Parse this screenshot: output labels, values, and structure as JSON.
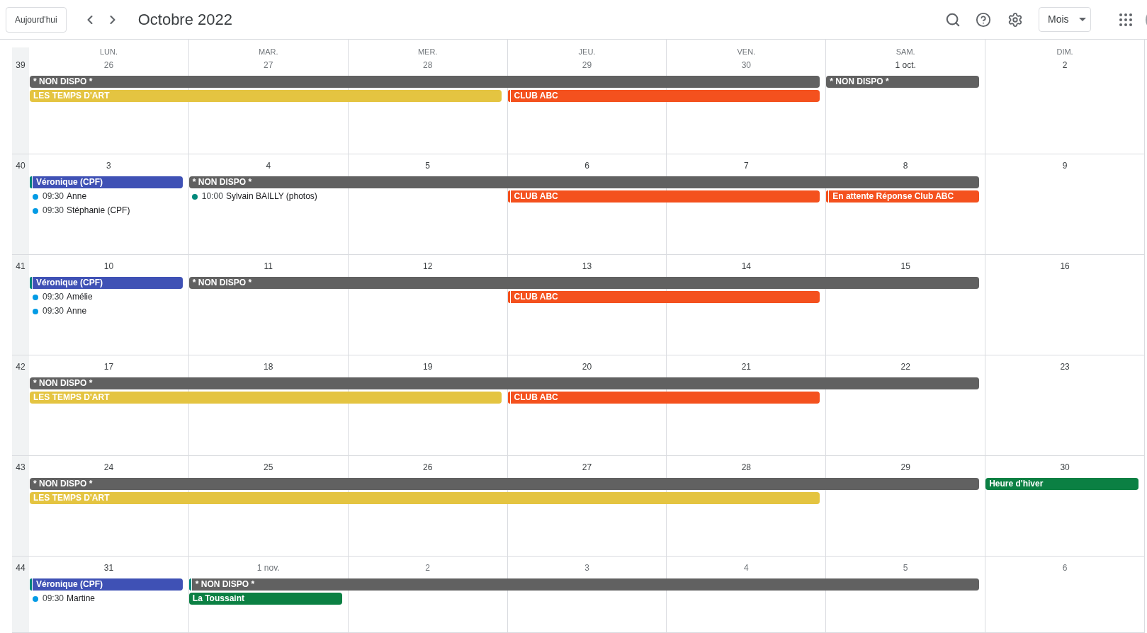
{
  "toolbar": {
    "today_button": "Aujourd'hui",
    "title": "Octobre 2022",
    "view_button": "Mois"
  },
  "day_names": [
    "LUN.",
    "MAR.",
    "MER.",
    "JEU.",
    "VEN.",
    "SAM.",
    "DIM."
  ],
  "weeks": [
    {
      "number": "39",
      "days": [
        {
          "label": "26",
          "in_month": false
        },
        {
          "label": "27",
          "in_month": false
        },
        {
          "label": "28",
          "in_month": false
        },
        {
          "label": "29",
          "in_month": false
        },
        {
          "label": "30",
          "in_month": false
        },
        {
          "label": "1 oct.",
          "in_month": true
        },
        {
          "label": "2",
          "in_month": true
        }
      ],
      "lanes": [
        [
          {
            "kind": "bar",
            "title": "* NON DISPO *",
            "color": "#616161"
          },
          {
            "kind": "continued"
          },
          {
            "kind": "continued"
          },
          {
            "kind": "continued"
          },
          {
            "kind": "continued"
          },
          {
            "kind": "bar",
            "title": "* NON DISPO *",
            "color": "#616161"
          }
        ],
        [
          {
            "kind": "bar",
            "title": "LES TEMPS D'ART",
            "color": "#e4c441"
          },
          {
            "kind": "continued"
          },
          {
            "kind": "continued"
          },
          {
            "kind": "bar",
            "title": "CLUB ABC",
            "color": "#f4511e",
            "stripe": {
              "color": "#f4511e"
            }
          },
          {
            "kind": "continued"
          }
        ]
      ]
    },
    {
      "number": "40",
      "days": [
        {
          "label": "3",
          "in_month": true
        },
        {
          "label": "4",
          "in_month": true
        },
        {
          "label": "5",
          "in_month": true
        },
        {
          "label": "6",
          "in_month": true
        },
        {
          "label": "7",
          "in_month": true
        },
        {
          "label": "8",
          "in_month": true
        },
        {
          "label": "9",
          "in_month": true
        }
      ],
      "lanes": [
        [
          {
            "kind": "bar",
            "title": "Véronique (CPF)",
            "color": "#3f51b5",
            "stripe": {
              "color": "#00897b"
            }
          },
          {
            "kind": "bar",
            "title": "* NON DISPO *",
            "color": "#616161"
          },
          {
            "kind": "continued"
          },
          {
            "kind": "continued"
          },
          {
            "kind": "continued"
          },
          {
            "kind": "continued"
          }
        ],
        [
          {
            "kind": "timed",
            "time": "09:30",
            "title": "Anne",
            "color": "#039be5"
          },
          {
            "kind": "timed",
            "time": "10:00",
            "title": "Sylvain BAILLY (photos)",
            "color": "#00897b"
          },
          {
            "kind": "free"
          },
          {
            "kind": "bar",
            "title": "CLUB ABC",
            "color": "#f4511e",
            "stripe": {
              "color": "#f4511e"
            }
          },
          {
            "kind": "continued"
          },
          {
            "kind": "bar",
            "title": "En attente Réponse Club ABC",
            "color": "#f4511e",
            "stripe": {
              "color": "#f4511e"
            }
          }
        ],
        [
          {
            "kind": "timed",
            "time": "09:30",
            "title": "Stéphanie (CPF)",
            "color": "#039be5"
          }
        ]
      ]
    },
    {
      "number": "41",
      "days": [
        {
          "label": "10",
          "in_month": true
        },
        {
          "label": "11",
          "in_month": true
        },
        {
          "label": "12",
          "in_month": true
        },
        {
          "label": "13",
          "in_month": true
        },
        {
          "label": "14",
          "in_month": true
        },
        {
          "label": "15",
          "in_month": true
        },
        {
          "label": "16",
          "in_month": true
        }
      ],
      "lanes": [
        [
          {
            "kind": "bar",
            "title": "Véronique (CPF)",
            "color": "#3f51b5",
            "stripe": {
              "color": "#00897b"
            }
          },
          {
            "kind": "bar",
            "title": "* NON DISPO *",
            "color": "#616161"
          },
          {
            "kind": "continued"
          },
          {
            "kind": "continued"
          },
          {
            "kind": "continued"
          },
          {
            "kind": "continued"
          }
        ],
        [
          {
            "kind": "timed",
            "time": "09:30",
            "title": "Amélie",
            "color": "#039be5"
          },
          {
            "kind": "free"
          },
          {
            "kind": "free"
          },
          {
            "kind": "bar",
            "title": "CLUB ABC",
            "color": "#f4511e",
            "stripe": {
              "color": "#f4511e"
            }
          },
          {
            "kind": "continued"
          }
        ],
        [
          {
            "kind": "timed",
            "time": "09:30",
            "title": "Anne",
            "color": "#039be5"
          }
        ]
      ]
    },
    {
      "number": "42",
      "days": [
        {
          "label": "17",
          "in_month": true
        },
        {
          "label": "18",
          "in_month": true
        },
        {
          "label": "19",
          "in_month": true
        },
        {
          "label": "20",
          "in_month": true
        },
        {
          "label": "21",
          "in_month": true
        },
        {
          "label": "22",
          "in_month": true
        },
        {
          "label": "23",
          "in_month": true
        }
      ],
      "lanes": [
        [
          {
            "kind": "bar",
            "title": "* NON DISPO *",
            "color": "#616161"
          },
          {
            "kind": "continued"
          },
          {
            "kind": "continued"
          },
          {
            "kind": "continued"
          },
          {
            "kind": "continued"
          },
          {
            "kind": "continued"
          }
        ],
        [
          {
            "kind": "bar",
            "title": "LES TEMPS D'ART",
            "color": "#e4c441"
          },
          {
            "kind": "continued"
          },
          {
            "kind": "continued"
          },
          {
            "kind": "bar",
            "title": "CLUB ABC",
            "color": "#f4511e",
            "stripe": {
              "color": "#f4511e"
            }
          },
          {
            "kind": "continued"
          }
        ]
      ]
    },
    {
      "number": "43",
      "days": [
        {
          "label": "24",
          "in_month": true
        },
        {
          "label": "25",
          "in_month": true
        },
        {
          "label": "26",
          "in_month": true
        },
        {
          "label": "27",
          "in_month": true
        },
        {
          "label": "28",
          "in_month": true
        },
        {
          "label": "29",
          "in_month": true
        },
        {
          "label": "30",
          "in_month": true
        }
      ],
      "lanes": [
        [
          {
            "kind": "bar",
            "title": "* NON DISPO *",
            "color": "#616161"
          },
          {
            "kind": "continued"
          },
          {
            "kind": "continued"
          },
          {
            "kind": "continued"
          },
          {
            "kind": "continued"
          },
          {
            "kind": "continued"
          },
          {
            "kind": "bar",
            "title": "Heure d'hiver",
            "color": "#0b8043"
          }
        ],
        [
          {
            "kind": "bar",
            "title": "LES TEMPS D'ART",
            "color": "#e4c441"
          },
          {
            "kind": "continued"
          },
          {
            "kind": "continued"
          },
          {
            "kind": "continued"
          },
          {
            "kind": "continued"
          }
        ]
      ]
    },
    {
      "number": "44",
      "days": [
        {
          "label": "31",
          "in_month": true
        },
        {
          "label": "1 nov.",
          "in_month": false
        },
        {
          "label": "2",
          "in_month": false
        },
        {
          "label": "3",
          "in_month": false
        },
        {
          "label": "4",
          "in_month": false
        },
        {
          "label": "5",
          "in_month": false
        },
        {
          "label": "6",
          "in_month": false
        }
      ],
      "lanes": [
        [
          {
            "kind": "bar",
            "title": "Véronique (CPF)",
            "color": "#3f51b5",
            "stripe": {
              "color": "#00897b"
            }
          },
          {
            "kind": "bar",
            "title": "* NON DISPO *",
            "color": "#616161",
            "stripe": {
              "color": "#00897b"
            }
          },
          {
            "kind": "continued"
          },
          {
            "kind": "continued"
          },
          {
            "kind": "continued"
          },
          {
            "kind": "continued"
          }
        ],
        [
          {
            "kind": "timed",
            "time": "09:30",
            "title": "Martine",
            "color": "#039be5"
          },
          {
            "kind": "bar",
            "title": "La Toussaint",
            "color": "#0b8043"
          }
        ]
      ]
    }
  ]
}
